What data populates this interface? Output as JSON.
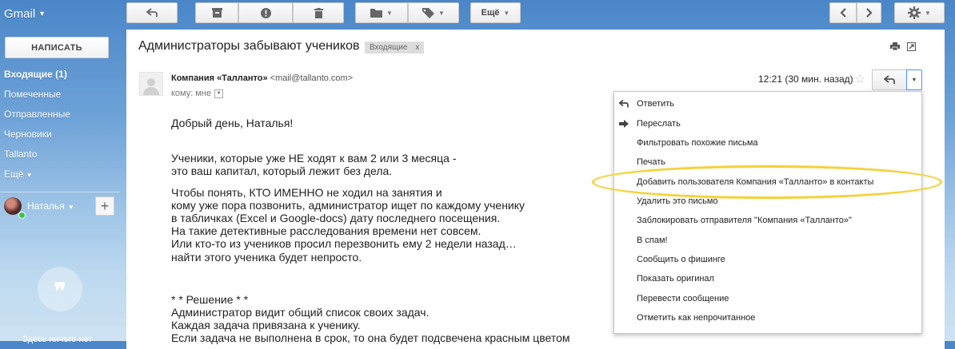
{
  "app": {
    "logo": "Gmail"
  },
  "toolbar": {
    "more_label": "Ещё",
    "icons": [
      "back-icon",
      "archive-icon",
      "spam-icon",
      "delete-icon",
      "folder-icon",
      "label-icon",
      "prev-icon",
      "next-icon",
      "settings-icon"
    ]
  },
  "sidebar": {
    "compose_label": "НАПИСАТЬ",
    "items": [
      {
        "label": "Входящие (1)",
        "active": true
      },
      {
        "label": "Помеченные"
      },
      {
        "label": "Отправленные"
      },
      {
        "label": "Черновики"
      },
      {
        "label": "Tallanto"
      },
      {
        "label": "Ещё"
      }
    ],
    "user_name": "Наталья",
    "add_label": "+",
    "hangouts_text": "Здесь ничего нет"
  },
  "email": {
    "subject": "Администраторы забывают учеников",
    "label": "Входящие",
    "label_close": "x",
    "sender_name": "Компания «Талланто»",
    "sender_email": "<mail@tallanto.com>",
    "to": "кому: мне",
    "timestamp": "12:21 (30 мин. назад)",
    "body": [
      "Добрый день, Наталья!",
      "Ученики, которые уже НЕ ходят к вам 2 или 3 месяца -",
      "это ваш капитал, который лежит без дела.",
      "Чтобы понять, КТО ИМЕННО не ходил на занятия и",
      "кому уже пора позвонить, администратор ищет по каждому ученику",
      "в табличках (Excel и Google-docs) дату последнего посещения.",
      "На такие детективные расследования времени нет совсем.",
      "Или кто-то из учеников просил перезвонить ему 2 недели назад…",
      "найти этого ученика будет непросто.",
      "* * Решение * *",
      "Администратор видит общий список своих задач.",
      "Каждая задача привязана к ученику.",
      "Если задача не выполнена в срок, то она будет подсвечена красным цветом"
    ]
  },
  "menu": {
    "items": [
      "Ответить",
      "Переслать",
      "Фильтровать похожие письма",
      "Печать",
      "Добавить пользователя Компания «Талланто» в контакты",
      "Удалить это письмо",
      "Заблокировать отправителя \"Компания «Талланто»\"",
      "В спам!",
      "Сообщить о фишинге",
      "Показать оригинал",
      "Перевести сообщение",
      "Отметить как непрочитанное"
    ]
  },
  "colors": {
    "highlight": "#f2d23c",
    "focus_border": "#4d90fe"
  }
}
